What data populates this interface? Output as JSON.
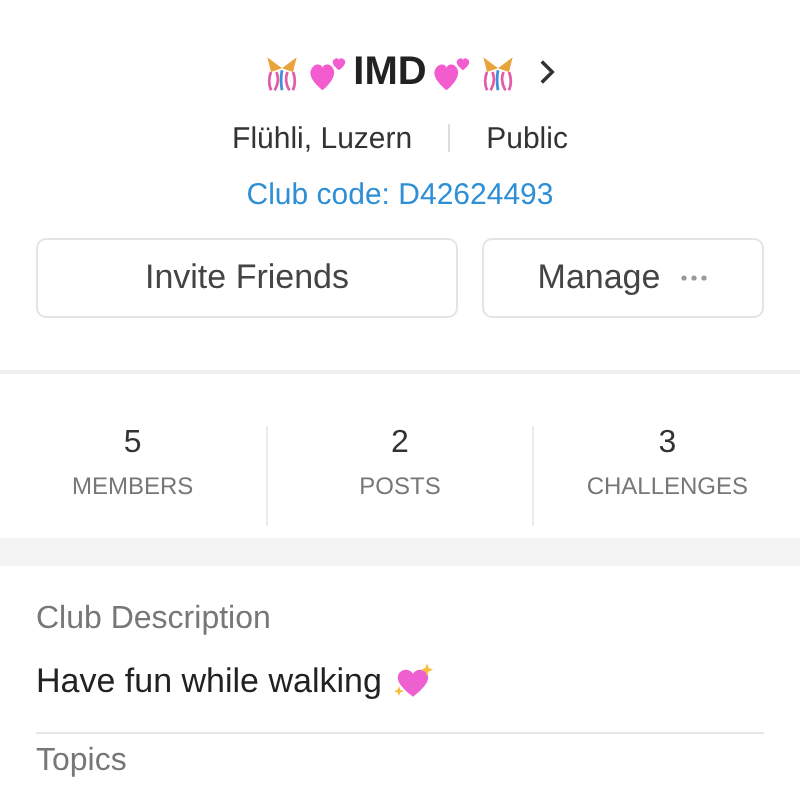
{
  "club": {
    "name": "IMD",
    "location": "Flühli, Luzern",
    "visibility": "Public",
    "code": "Club code: D42624493"
  },
  "buttons": [
    {
      "label": "Invite Friends",
      "kind": "plain"
    },
    {
      "label": "Manage",
      "kind": "more"
    }
  ],
  "stats": [
    {
      "value": "5",
      "label": "MEMBERS"
    },
    {
      "value": "2",
      "label": "POSTS"
    },
    {
      "value": "3",
      "label": "CHALLENGES"
    }
  ],
  "description": {
    "heading": "Club Description",
    "text": "Have fun while walking"
  },
  "next_section": {
    "heading": "Topics"
  }
}
